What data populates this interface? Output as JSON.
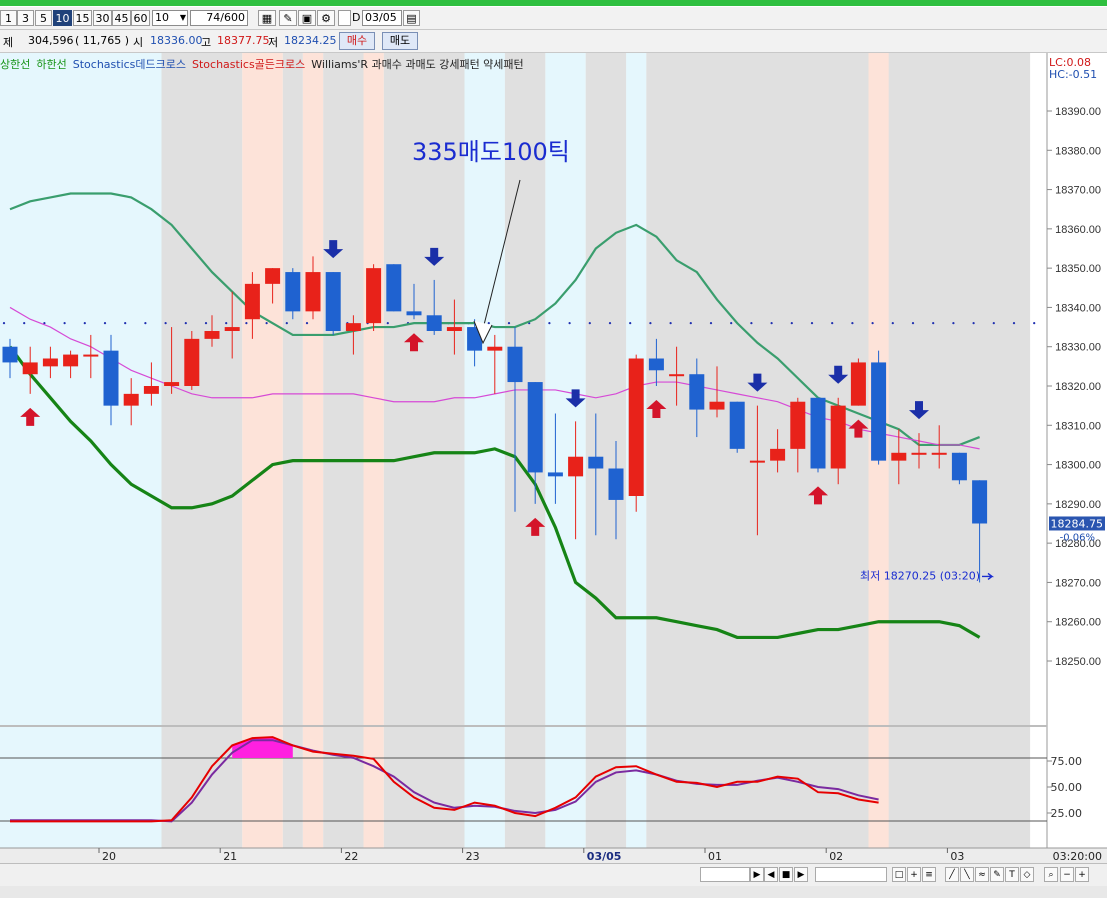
{
  "toolbar": {
    "intervals": [
      "1",
      "3",
      "5",
      "10",
      "15",
      "30",
      "45",
      "60"
    ],
    "active_interval": "10",
    "interval_select": "10",
    "count_value": "74/600",
    "date_value": "03/05",
    "d_label": "D"
  },
  "quote": {
    "label": "제",
    "volume": "304,596",
    "change": "( 11,765 )",
    "open_label": "시",
    "open": "18336.00",
    "high_label": "고",
    "high": "18377.75",
    "low_label": "저",
    "low": "18234.25",
    "buy_label": "매수",
    "sell_label": "매도"
  },
  "legend": {
    "item1": "상한선",
    "item2": "하한선",
    "item3": "Stochastics데드크로스",
    "item4": "Stochastics골든크로스",
    "item5": "Williams'R 과매수 과매도 강세패턴  약세패턴"
  },
  "annotation": {
    "text": "335매도100틱"
  },
  "axis_info": {
    "lc": "LC:0.08",
    "hc": "HC:-0.51"
  },
  "price_tag": {
    "value": "18284.75",
    "change": "-0.06%"
  },
  "low_note": {
    "text": "최저 18270.25 (03:20)"
  },
  "colors": {
    "up": "#e8221a",
    "down": "#1f62d0",
    "upper_band": "#3a9e6e",
    "lower_band": "#168416",
    "ma": "#d64ad6",
    "stoch_k": "#e60000",
    "stoch_d": "#7a2aa0"
  },
  "chart_data": {
    "type": "candlestick",
    "ylim": [
      18244,
      18402
    ],
    "y_ticks": [
      "18250.00",
      "18260.00",
      "18270.00",
      "18280.00",
      "18290.00",
      "18300.00",
      "18310.00",
      "18320.00",
      "18330.00",
      "18340.00",
      "18350.00",
      "18360.00",
      "18370.00",
      "18380.00",
      "18390.00"
    ],
    "y_tick_values": [
      18250,
      18260,
      18270,
      18280,
      18290,
      18300,
      18310,
      18320,
      18330,
      18340,
      18350,
      18360,
      18370,
      18380,
      18390
    ],
    "x_ticks": [
      {
        "label": "20",
        "i": 5
      },
      {
        "label": "21",
        "i": 11
      },
      {
        "label": "22",
        "i": 17
      },
      {
        "label": "23",
        "i": 23
      },
      {
        "label": "03/05",
        "i": 29
      },
      {
        "label": "01",
        "i": 35
      },
      {
        "label": "02",
        "i": 41
      },
      {
        "label": "03",
        "i": 47
      }
    ],
    "time_label": "03:20:00",
    "candles": [
      {
        "o": 18330,
        "h": 18332,
        "l": 18322,
        "c": 18326
      },
      {
        "o": 18323,
        "h": 18330,
        "l": 18318,
        "c": 18326
      },
      {
        "o": 18325,
        "h": 18330,
        "l": 18322,
        "c": 18327
      },
      {
        "o": 18325,
        "h": 18329,
        "l": 18322,
        "c": 18328
      },
      {
        "o": 18328,
        "h": 18333,
        "l": 18322,
        "c": 18328
      },
      {
        "o": 18329,
        "h": 18333,
        "l": 18310,
        "c": 18315
      },
      {
        "o": 18315,
        "h": 18322,
        "l": 18310,
        "c": 18318
      },
      {
        "o": 18318,
        "h": 18326,
        "l": 18315,
        "c": 18320
      },
      {
        "o": 18320,
        "h": 18335,
        "l": 18318,
        "c": 18321
      },
      {
        "o": 18320,
        "h": 18334,
        "l": 18319,
        "c": 18332
      },
      {
        "o": 18332,
        "h": 18338,
        "l": 18330,
        "c": 18334
      },
      {
        "o": 18334,
        "h": 18344,
        "l": 18327,
        "c": 18335
      },
      {
        "o": 18337,
        "h": 18349,
        "l": 18332,
        "c": 18346
      },
      {
        "o": 18346,
        "h": 18350,
        "l": 18341,
        "c": 18350
      },
      {
        "o": 18349,
        "h": 18350,
        "l": 18337,
        "c": 18339
      },
      {
        "o": 18339,
        "h": 18353,
        "l": 18337,
        "c": 18349
      },
      {
        "o": 18349,
        "h": 18349,
        "l": 18333,
        "c": 18334
      },
      {
        "o": 18334,
        "h": 18338,
        "l": 18328,
        "c": 18336
      },
      {
        "o": 18336,
        "h": 18351,
        "l": 18334,
        "c": 18350
      },
      {
        "o": 18351,
        "h": 18351,
        "l": 18339,
        "c": 18339
      },
      {
        "o": 18339,
        "h": 18346,
        "l": 18337,
        "c": 18338
      },
      {
        "o": 18338,
        "h": 18347,
        "l": 18333,
        "c": 18334
      },
      {
        "o": 18334,
        "h": 18342,
        "l": 18328,
        "c": 18335
      },
      {
        "o": 18335,
        "h": 18337,
        "l": 18325,
        "c": 18329
      },
      {
        "o": 18329,
        "h": 18333,
        "l": 18318,
        "c": 18330
      },
      {
        "o": 18330,
        "h": 18335,
        "l": 18288,
        "c": 18321
      },
      {
        "o": 18321,
        "h": 18321,
        "l": 18290,
        "c": 18298
      },
      {
        "o": 18298,
        "h": 18313,
        "l": 18290,
        "c": 18297
      },
      {
        "o": 18297,
        "h": 18311,
        "l": 18281,
        "c": 18302
      },
      {
        "o": 18302,
        "h": 18313,
        "l": 18282,
        "c": 18299
      },
      {
        "o": 18299,
        "h": 18306,
        "l": 18281,
        "c": 18291
      },
      {
        "o": 18292,
        "h": 18328,
        "l": 18288,
        "c": 18327
      },
      {
        "o": 18327,
        "h": 18332,
        "l": 18320,
        "c": 18324
      },
      {
        "o": 18323,
        "h": 18330,
        "l": 18315,
        "c": 18323
      },
      {
        "o": 18323,
        "h": 18327,
        "l": 18307,
        "c": 18314
      },
      {
        "o": 18314,
        "h": 18325,
        "l": 18312,
        "c": 18316
      },
      {
        "o": 18316,
        "h": 18316,
        "l": 18303,
        "c": 18304
      },
      {
        "o": 18301,
        "h": 18315,
        "l": 18282,
        "c": 18301
      },
      {
        "o": 18301,
        "h": 18309,
        "l": 18298,
        "c": 18304
      },
      {
        "o": 18304,
        "h": 18317,
        "l": 18298,
        "c": 18316
      },
      {
        "o": 18317,
        "h": 18317,
        "l": 18298,
        "c": 18299
      },
      {
        "o": 18299,
        "h": 18317,
        "l": 18295,
        "c": 18315
      },
      {
        "o": 18315,
        "h": 18327,
        "l": 18315,
        "c": 18326
      },
      {
        "o": 18326,
        "h": 18329,
        "l": 18300,
        "c": 18301
      },
      {
        "o": 18301,
        "h": 18309,
        "l": 18295,
        "c": 18303
      },
      {
        "o": 18303,
        "h": 18308,
        "l": 18299,
        "c": 18303
      },
      {
        "o": 18303,
        "h": 18310,
        "l": 18299,
        "c": 18303
      },
      {
        "o": 18303,
        "h": 18303,
        "l": 18295,
        "c": 18296
      },
      {
        "o": 18296,
        "h": 18296,
        "l": 18270,
        "c": 18285
      }
    ],
    "upper_band": [
      18365,
      18367,
      18368,
      18369,
      18369,
      18369,
      18368,
      18365,
      18361,
      18355,
      18349,
      18344,
      18339,
      18336,
      18333,
      18333,
      18333,
      18334,
      18335,
      18335,
      18336,
      18336,
      18336,
      18336,
      18335,
      18335,
      18337,
      18341,
      18347,
      18355,
      18359,
      18361,
      18358,
      18352,
      18349,
      18342,
      18336,
      18331,
      18327,
      18322,
      18317,
      18315,
      18313,
      18311,
      18309,
      18305,
      18305,
      18305,
      18307
    ],
    "lower_band": [
      18330,
      18323,
      18317,
      18311,
      18306,
      18300,
      18295,
      18292,
      18289,
      18289,
      18290,
      18292,
      18296,
      18300,
      18301,
      18301,
      18301,
      18301,
      18301,
      18301,
      18302,
      18303,
      18303,
      18303,
      18304,
      18302,
      18295,
      18284,
      18270,
      18266,
      18261,
      18261,
      18261,
      18260,
      18259,
      18258,
      18256,
      18256,
      18256,
      18257,
      18258,
      18258,
      18259,
      18260,
      18260,
      18260,
      18260,
      18259,
      18256
    ],
    "ma_line": [
      18340,
      18337,
      18335,
      18332,
      18330,
      18327,
      18324,
      18322,
      18320,
      18318,
      18317,
      18317,
      18317,
      18318,
      18318,
      18318,
      18318,
      18318,
      18317,
      18316,
      18316,
      18316,
      18317,
      18317,
      18318,
      18319,
      18319,
      18319,
      18318,
      18317,
      18318,
      18320,
      18321,
      18321,
      18320,
      18319,
      18318,
      18317,
      18316,
      18314,
      18312,
      18311,
      18309,
      18308,
      18307,
      18306,
      18305,
      18305,
      18304
    ],
    "dotted_level": 18336,
    "buy_signals": [
      1,
      20,
      26,
      32,
      40,
      42
    ],
    "sell_signals": [
      16,
      21,
      28,
      37,
      41,
      45
    ],
    "red_zones": [
      [
        12,
        13
      ],
      [
        15,
        15
      ],
      [
        18,
        18
      ],
      [
        43,
        43
      ]
    ],
    "gray_zones": [
      [
        8,
        11
      ],
      [
        14,
        14
      ],
      [
        16,
        17
      ],
      [
        19,
        22
      ],
      [
        25,
        26
      ],
      [
        29,
        30
      ],
      [
        32,
        50
      ]
    ],
    "blue_zones": [
      [
        0,
        7
      ],
      [
        23,
        24
      ],
      [
        27,
        28
      ],
      [
        31,
        31
      ]
    ],
    "stochastic": {
      "y_ticks": [
        "75.00",
        "50.00",
        "25.00"
      ],
      "y_tick_values": [
        75,
        50,
        25
      ],
      "k": [
        17,
        17,
        17,
        17,
        17,
        17,
        17,
        17,
        18,
        40,
        70,
        90,
        97,
        98,
        90,
        84,
        82,
        80,
        77,
        55,
        40,
        30,
        28,
        35,
        32,
        25,
        22,
        30,
        40,
        60,
        69,
        70,
        62,
        55,
        54,
        50,
        55,
        55,
        60,
        58,
        45,
        44,
        38,
        35
      ],
      "d": [
        18,
        18,
        18,
        18,
        18,
        18,
        18,
        18,
        17,
        35,
        62,
        83,
        95,
        95,
        90,
        85,
        81,
        78,
        70,
        60,
        45,
        35,
        30,
        32,
        31,
        27,
        25,
        28,
        36,
        55,
        64,
        66,
        62,
        56,
        53,
        52,
        52,
        56,
        59,
        55,
        50,
        48,
        42,
        38
      ],
      "k_start": 5,
      "overbought": [
        11,
        14
      ],
      "oversold": [
        0,
        7
      ]
    }
  }
}
